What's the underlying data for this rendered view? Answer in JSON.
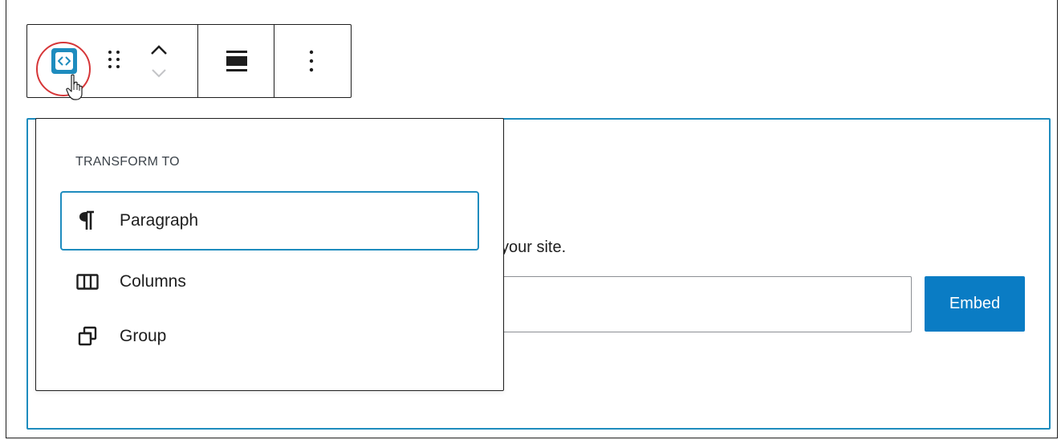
{
  "toolbar": {
    "block_type_icon": "embed-code-icon",
    "drag_icon": "drag-handle-icon",
    "move_up_icon": "chevron-up-icon",
    "move_down_icon": "chevron-down-icon",
    "align_icon": "align-wide-icon",
    "more_icon": "more-vertical-icon"
  },
  "embed": {
    "instructions": "your site.",
    "input_value": "",
    "button_label": "Embed"
  },
  "popover": {
    "heading": "TRANSFORM TO",
    "items": [
      {
        "label": "Paragraph",
        "icon": "paragraph-icon"
      },
      {
        "label": "Columns",
        "icon": "columns-icon"
      },
      {
        "label": "Group",
        "icon": "group-icon"
      }
    ]
  },
  "colors": {
    "accent": "#1e8cbe",
    "button": "#0a7cc4",
    "highlight": "#d63638",
    "border": "#1e1e1e"
  }
}
